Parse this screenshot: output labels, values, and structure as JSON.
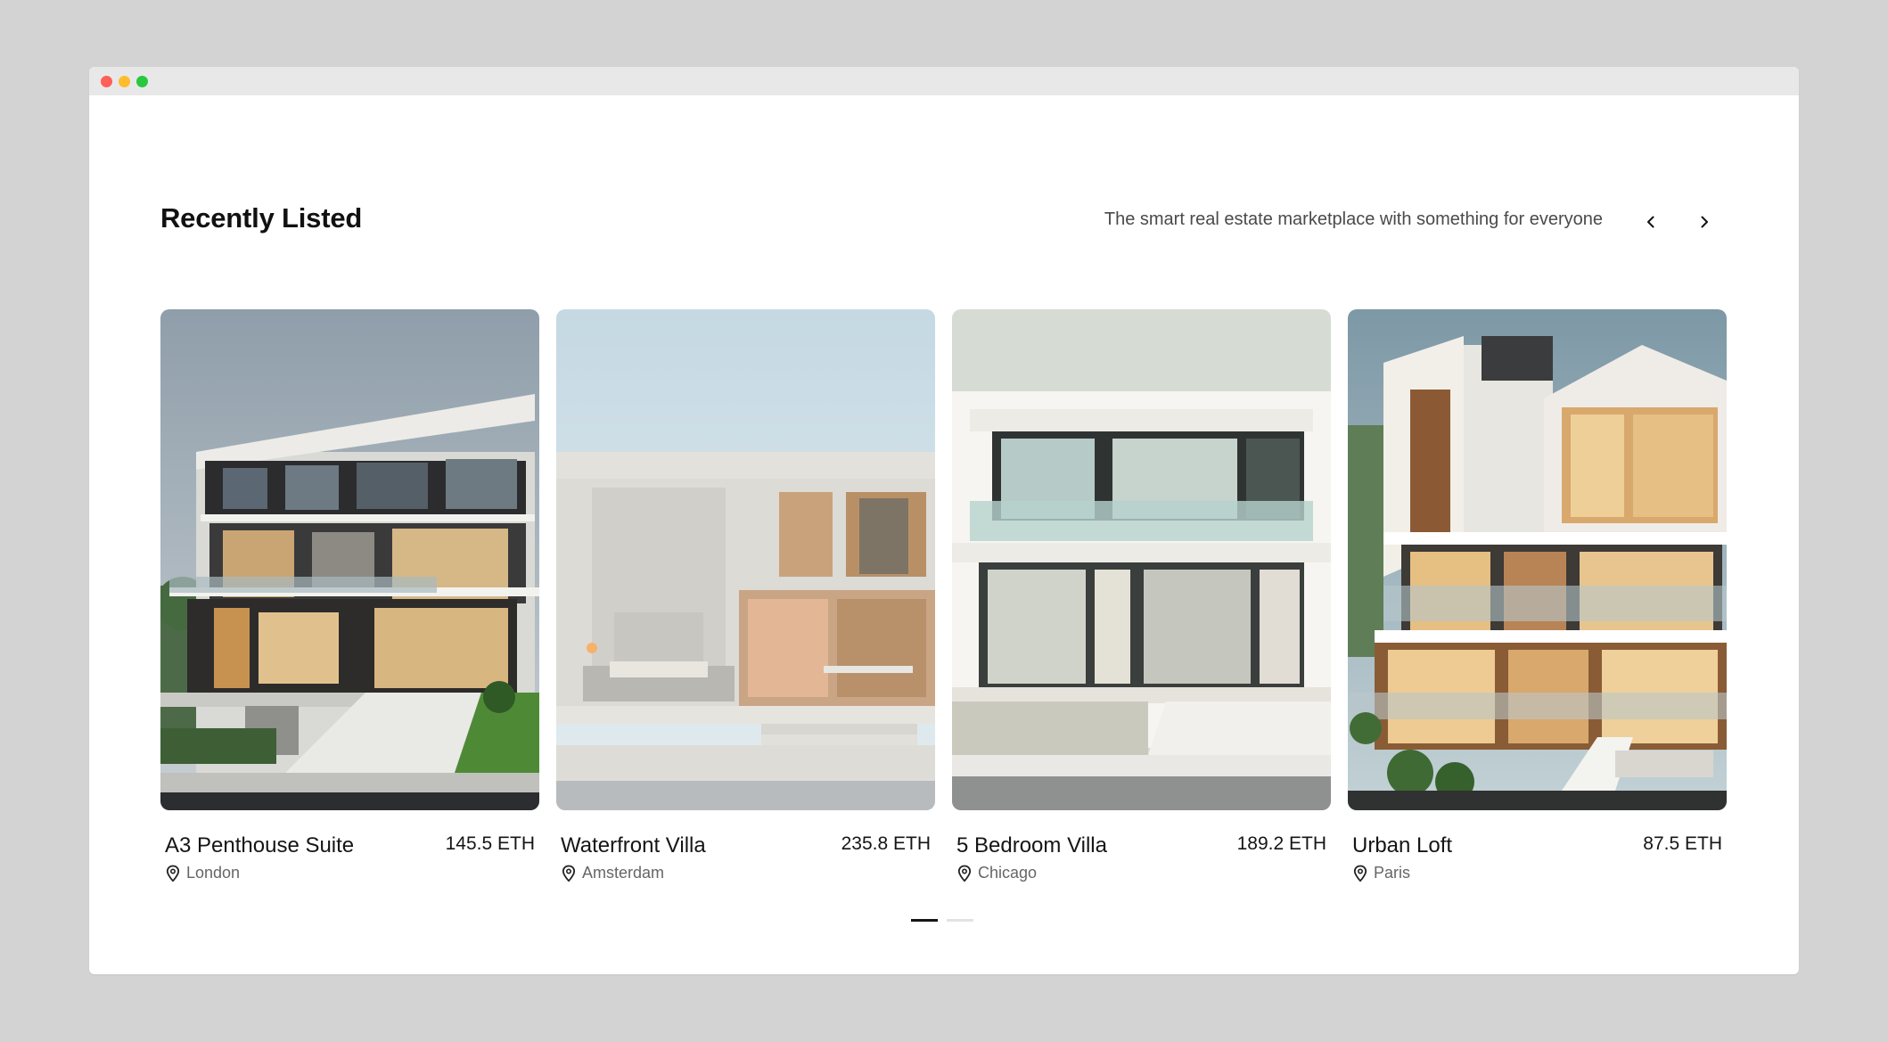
{
  "section": {
    "title": "Recently Listed",
    "tagline": "The smart real estate marketplace with something for everyone"
  },
  "navigation": {
    "prev_icon": "chevron-left-icon",
    "next_icon": "chevron-right-icon"
  },
  "listings": [
    {
      "title": "A3 Penthouse Suite",
      "price": "145.5 ETH",
      "location": "London"
    },
    {
      "title": "Waterfront Villa",
      "price": "235.8 ETH",
      "location": "Amsterdam"
    },
    {
      "title": "5 Bedroom Villa",
      "price": "189.2 ETH",
      "location": "Chicago"
    },
    {
      "title": "Urban Loft",
      "price": "87.5 ETH",
      "location": "Paris"
    }
  ],
  "pagination": {
    "pages": 2,
    "active_page": 1
  },
  "colors": {
    "background": "#d3d3d3",
    "window": "#ffffff",
    "text": "#151515",
    "muted": "#666666",
    "pager_active": "#151515",
    "pager_inactive": "#e3e3e3"
  }
}
